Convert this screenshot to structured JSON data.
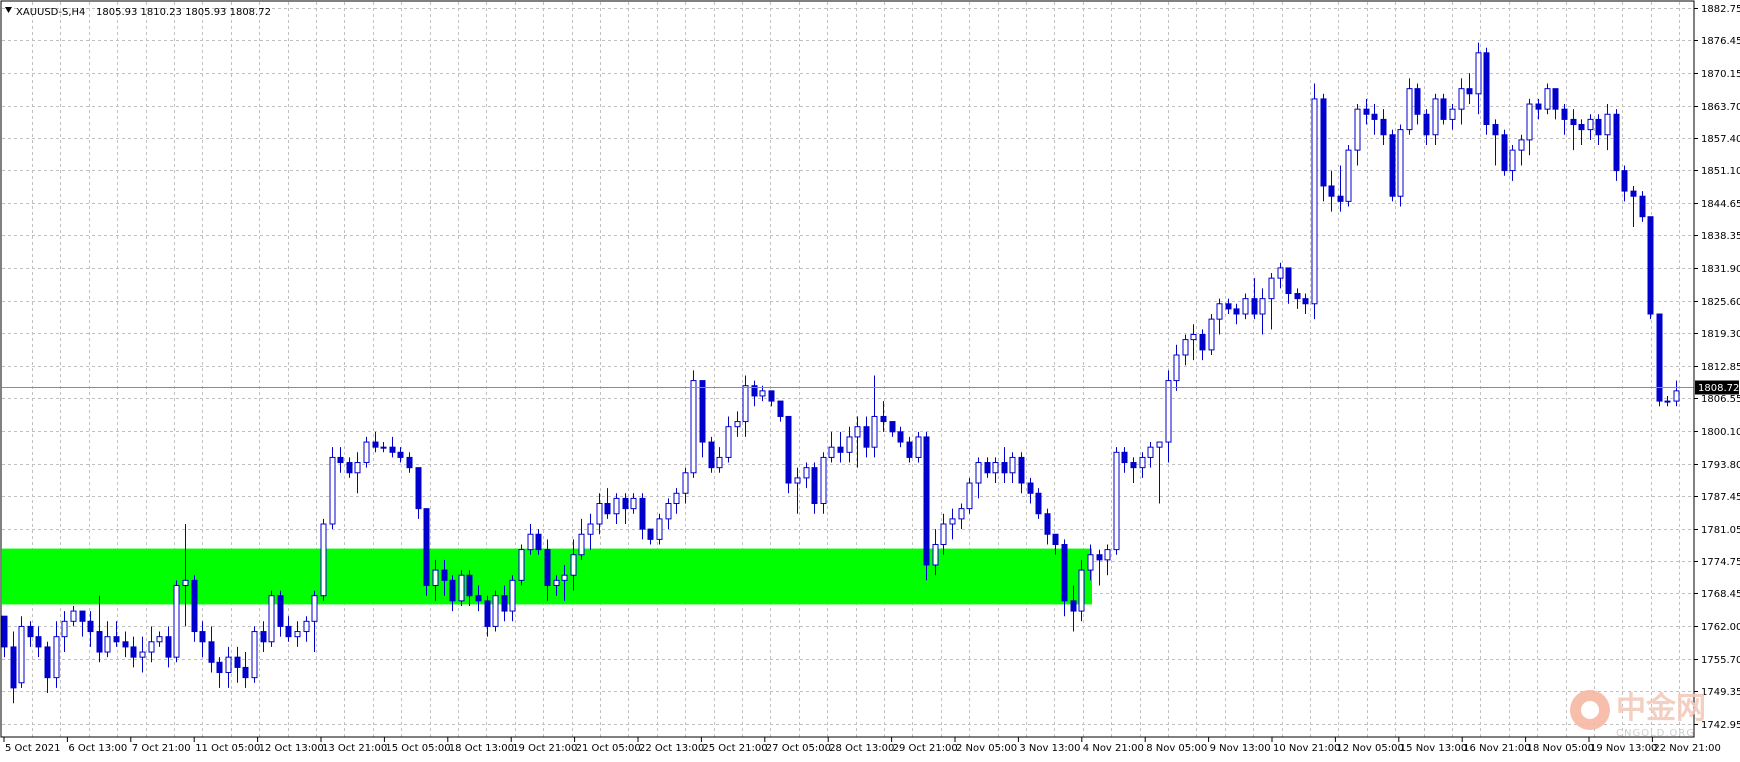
{
  "header": {
    "symbol": "XAUUSD-S,H4",
    "ohlc": "1805.93 1810.23 1805.93 1808.72"
  },
  "current_price": "1808.72",
  "watermark": {
    "brand": "中金网",
    "domain": "CNGOLD.ORG"
  },
  "colors": {
    "candle": "#0000cc",
    "zone": "#00ff00",
    "grid": "#c0c0c0",
    "flag": "#000000"
  },
  "chart_data": {
    "type": "candlestick",
    "symbol": "XAUUSD-S",
    "timeframe": "H4",
    "ylim": [
      1742.95,
      1882.75
    ],
    "y_ticks": [
      "1882.75",
      "1876.45",
      "1870.15",
      "1863.70",
      "1857.40",
      "1851.10",
      "1844.65",
      "1838.35",
      "1831.90",
      "1825.60",
      "1819.30",
      "1812.85",
      "1806.55",
      "1800.10",
      "1793.80",
      "1787.45",
      "1781.05",
      "1774.75",
      "1768.45",
      "1762.00",
      "1755.70",
      "1749.35",
      "1742.95"
    ],
    "x_ticks": [
      "5 Oct 2021",
      "6 Oct 13:00",
      "7 Oct 21:00",
      "11 Oct 05:00",
      "12 Oct 13:00",
      "13 Oct 21:00",
      "15 Oct 05:00",
      "18 Oct 13:00",
      "19 Oct 21:00",
      "21 Oct 05:00",
      "22 Oct 13:00",
      "25 Oct 21:00",
      "27 Oct 05:00",
      "28 Oct 13:00",
      "29 Oct 21:00",
      "2 Nov 05:00",
      "3 Nov 13:00",
      "4 Nov 21:00",
      "8 Nov 05:00",
      "9 Nov 13:00",
      "10 Nov 21:00",
      "12 Nov 05:00",
      "15 Nov 13:00",
      "16 Nov 21:00",
      "18 Nov 05:00",
      "19 Nov 13:00",
      "22 Nov 21:00"
    ],
    "current_price": 1808.72,
    "support_zone": [
      1766.3,
      1777.2
    ],
    "candles": [
      [
        1764,
        1764,
        1756,
        1758
      ],
      [
        1758,
        1761,
        1747,
        1750
      ],
      [
        1751,
        1764,
        1750,
        1762
      ],
      [
        1762,
        1763,
        1758,
        1760
      ],
      [
        1760,
        1762,
        1756,
        1758
      ],
      [
        1758,
        1759,
        1749,
        1752
      ],
      [
        1752,
        1763,
        1750,
        1760
      ],
      [
        1760,
        1765,
        1757,
        1763
      ],
      [
        1763,
        1766,
        1762,
        1765
      ],
      [
        1765,
        1765,
        1760,
        1763
      ],
      [
        1763,
        1765,
        1758,
        1761
      ],
      [
        1761,
        1768,
        1755,
        1757
      ],
      [
        1757,
        1763,
        1756,
        1760
      ],
      [
        1760,
        1763,
        1758,
        1759
      ],
      [
        1759,
        1761,
        1756,
        1758
      ],
      [
        1758,
        1760,
        1754,
        1756
      ],
      [
        1756,
        1760,
        1753,
        1757
      ],
      [
        1757,
        1762,
        1755,
        1759
      ],
      [
        1759,
        1761,
        1758,
        1760
      ],
      [
        1760,
        1762,
        1754,
        1756
      ],
      [
        1756,
        1771,
        1755,
        1770
      ],
      [
        1770,
        1782,
        1762,
        1771
      ],
      [
        1771,
        1772,
        1759,
        1761
      ],
      [
        1761,
        1763,
        1756,
        1759
      ],
      [
        1759,
        1762,
        1753,
        1755
      ],
      [
        1755,
        1756,
        1750,
        1753
      ],
      [
        1753,
        1758,
        1750,
        1756
      ],
      [
        1756,
        1758,
        1751,
        1754
      ],
      [
        1754,
        1757,
        1750,
        1752
      ],
      [
        1752,
        1762,
        1751,
        1761
      ],
      [
        1761,
        1763,
        1757,
        1759
      ],
      [
        1759,
        1769,
        1758,
        1768
      ],
      [
        1768,
        1769,
        1760,
        1762
      ],
      [
        1762,
        1764,
        1759,
        1760
      ],
      [
        1760,
        1763,
        1758,
        1761
      ],
      [
        1761,
        1764,
        1759,
        1763
      ],
      [
        1763,
        1769,
        1757,
        1768
      ],
      [
        1768,
        1783,
        1767,
        1782
      ],
      [
        1782,
        1797,
        1781,
        1795
      ],
      [
        1795,
        1797,
        1792,
        1794
      ],
      [
        1794,
        1795,
        1791,
        1792
      ],
      [
        1792,
        1796,
        1788,
        1794
      ],
      [
        1794,
        1799,
        1793,
        1798
      ],
      [
        1798,
        1800,
        1796,
        1797
      ],
      [
        1797,
        1798,
        1796,
        1797
      ],
      [
        1797,
        1799,
        1795,
        1796
      ],
      [
        1796,
        1797,
        1794,
        1795
      ],
      [
        1795,
        1796,
        1792,
        1793
      ],
      [
        1793,
        1793,
        1783,
        1785
      ],
      [
        1785,
        1785,
        1768,
        1770
      ],
      [
        1770,
        1775,
        1767,
        1773
      ],
      [
        1773,
        1775,
        1768,
        1771
      ],
      [
        1771,
        1772,
        1765,
        1767
      ],
      [
        1767,
        1773,
        1766,
        1772
      ],
      [
        1772,
        1773,
        1766,
        1768
      ],
      [
        1768,
        1770,
        1765,
        1767
      ],
      [
        1767,
        1768,
        1760,
        1762
      ],
      [
        1762,
        1769,
        1761,
        1768
      ],
      [
        1768,
        1770,
        1763,
        1765
      ],
      [
        1765,
        1772,
        1763,
        1771
      ],
      [
        1771,
        1778,
        1770,
        1777
      ],
      [
        1777,
        1782,
        1776,
        1780
      ],
      [
        1780,
        1781,
        1776,
        1777
      ],
      [
        1777,
        1779,
        1767,
        1770
      ],
      [
        1770,
        1772,
        1768,
        1771
      ],
      [
        1771,
        1774,
        1767,
        1772
      ],
      [
        1772,
        1779,
        1769,
        1776
      ],
      [
        1776,
        1783,
        1775,
        1780
      ],
      [
        1780,
        1784,
        1777,
        1782
      ],
      [
        1782,
        1788,
        1780,
        1786
      ],
      [
        1786,
        1789,
        1783,
        1784
      ],
      [
        1784,
        1788,
        1782,
        1787
      ],
      [
        1787,
        1788,
        1782,
        1785
      ],
      [
        1785,
        1788,
        1784,
        1787
      ],
      [
        1787,
        1788,
        1779,
        1781
      ],
      [
        1781,
        1781,
        1778,
        1779
      ],
      [
        1779,
        1784,
        1778,
        1783
      ],
      [
        1783,
        1787,
        1781,
        1786
      ],
      [
        1786,
        1789,
        1784,
        1788
      ],
      [
        1788,
        1793,
        1786,
        1792
      ],
      [
        1792,
        1812,
        1791,
        1810
      ],
      [
        1810,
        1810,
        1795,
        1798
      ],
      [
        1798,
        1799,
        1792,
        1793
      ],
      [
        1793,
        1797,
        1792,
        1795
      ],
      [
        1795,
        1803,
        1794,
        1801
      ],
      [
        1801,
        1804,
        1799,
        1802
      ],
      [
        1802,
        1811,
        1799,
        1809
      ],
      [
        1809,
        1810,
        1805,
        1807
      ],
      [
        1807,
        1809,
        1806,
        1808
      ],
      [
        1808,
        1808,
        1805,
        1806
      ],
      [
        1806,
        1806,
        1802,
        1803
      ],
      [
        1803,
        1803,
        1788,
        1790
      ],
      [
        1790,
        1793,
        1784,
        1791
      ],
      [
        1791,
        1794,
        1789,
        1793
      ],
      [
        1793,
        1794,
        1784,
        1786
      ],
      [
        1786,
        1796,
        1784,
        1795
      ],
      [
        1795,
        1800,
        1794,
        1797
      ],
      [
        1797,
        1800,
        1794,
        1796
      ],
      [
        1796,
        1801,
        1794,
        1799
      ],
      [
        1799,
        1803,
        1793,
        1801
      ],
      [
        1801,
        1803,
        1795,
        1797
      ],
      [
        1797,
        1811,
        1795,
        1803
      ],
      [
        1803,
        1806,
        1800,
        1802
      ],
      [
        1802,
        1802,
        1799,
        1800
      ],
      [
        1800,
        1801,
        1797,
        1798
      ],
      [
        1798,
        1799,
        1794,
        1795
      ],
      [
        1795,
        1800,
        1794,
        1799
      ],
      [
        1799,
        1800,
        1771,
        1774
      ],
      [
        1774,
        1781,
        1772,
        1778
      ],
      [
        1778,
        1784,
        1776,
        1782
      ],
      [
        1782,
        1785,
        1779,
        1783
      ],
      [
        1783,
        1786,
        1781,
        1785
      ],
      [
        1785,
        1791,
        1784,
        1790
      ],
      [
        1790,
        1795,
        1787,
        1794
      ],
      [
        1794,
        1795,
        1791,
        1792
      ],
      [
        1792,
        1795,
        1790,
        1794
      ],
      [
        1794,
        1797,
        1790,
        1792
      ],
      [
        1792,
        1796,
        1790,
        1795
      ],
      [
        1795,
        1796,
        1788,
        1790
      ],
      [
        1790,
        1791,
        1786,
        1788
      ],
      [
        1788,
        1789,
        1783,
        1784
      ],
      [
        1784,
        1785,
        1778,
        1780
      ],
      [
        1780,
        1780,
        1776,
        1778
      ],
      [
        1778,
        1779,
        1764,
        1767
      ],
      [
        1767,
        1770,
        1761,
        1765
      ],
      [
        1765,
        1775,
        1763,
        1773
      ],
      [
        1773,
        1778,
        1771,
        1776
      ],
      [
        1776,
        1777,
        1770,
        1775
      ],
      [
        1775,
        1778,
        1772,
        1777
      ],
      [
        1777,
        1797,
        1776,
        1796
      ],
      [
        1796,
        1797,
        1792,
        1794
      ],
      [
        1794,
        1795,
        1790,
        1793
      ],
      [
        1793,
        1796,
        1791,
        1795
      ],
      [
        1795,
        1798,
        1793,
        1797
      ],
      [
        1797,
        1798,
        1786,
        1798
      ],
      [
        1798,
        1812,
        1794,
        1810
      ],
      [
        1810,
        1817,
        1808,
        1815
      ],
      [
        1815,
        1819,
        1813,
        1818
      ],
      [
        1818,
        1821,
        1814,
        1819
      ],
      [
        1819,
        1820,
        1814,
        1816
      ],
      [
        1816,
        1823,
        1815,
        1822
      ],
      [
        1822,
        1826,
        1819,
        1825
      ],
      [
        1825,
        1826,
        1823,
        1824
      ],
      [
        1824,
        1825,
        1821,
        1823
      ],
      [
        1823,
        1827,
        1822,
        1826
      ],
      [
        1826,
        1830,
        1822,
        1823
      ],
      [
        1823,
        1828,
        1819,
        1826
      ],
      [
        1826,
        1831,
        1820,
        1830
      ],
      [
        1830,
        1833,
        1828,
        1832
      ],
      [
        1832,
        1832,
        1825,
        1827
      ],
      [
        1827,
        1828,
        1824,
        1826
      ],
      [
        1826,
        1827,
        1823,
        1825
      ],
      [
        1825,
        1868,
        1822,
        1865
      ],
      [
        1865,
        1866,
        1845,
        1848
      ],
      [
        1848,
        1851,
        1843,
        1846
      ],
      [
        1846,
        1852,
        1843,
        1845
      ],
      [
        1845,
        1856,
        1844,
        1855
      ],
      [
        1855,
        1864,
        1852,
        1863
      ],
      [
        1863,
        1865,
        1860,
        1862
      ],
      [
        1862,
        1864,
        1858,
        1861
      ],
      [
        1861,
        1863,
        1856,
        1858
      ],
      [
        1858,
        1859,
        1845,
        1846
      ],
      [
        1846,
        1860,
        1844,
        1859
      ],
      [
        1859,
        1869,
        1858,
        1867
      ],
      [
        1867,
        1868,
        1860,
        1862
      ],
      [
        1862,
        1863,
        1856,
        1858
      ],
      [
        1858,
        1866,
        1856,
        1865
      ],
      [
        1865,
        1866,
        1860,
        1861
      ],
      [
        1861,
        1864,
        1859,
        1863
      ],
      [
        1863,
        1869,
        1860,
        1867
      ],
      [
        1867,
        1870,
        1864,
        1866
      ],
      [
        1866,
        1876,
        1862,
        1874
      ],
      [
        1874,
        1875,
        1858,
        1860
      ],
      [
        1860,
        1861,
        1852,
        1858
      ],
      [
        1858,
        1859,
        1850,
        1851
      ],
      [
        1851,
        1856,
        1849,
        1855
      ],
      [
        1855,
        1858,
        1852,
        1857
      ],
      [
        1857,
        1865,
        1854,
        1864
      ],
      [
        1864,
        1865,
        1861,
        1863
      ],
      [
        1863,
        1868,
        1862,
        1867
      ],
      [
        1867,
        1867,
        1861,
        1863
      ],
      [
        1863,
        1864,
        1858,
        1861
      ],
      [
        1861,
        1863,
        1855,
        1860
      ],
      [
        1860,
        1861,
        1856,
        1859
      ],
      [
        1859,
        1862,
        1857,
        1861
      ],
      [
        1861,
        1862,
        1856,
        1858
      ],
      [
        1858,
        1864,
        1855,
        1862
      ],
      [
        1862,
        1863,
        1849,
        1851
      ],
      [
        1851,
        1852,
        1845,
        1847
      ],
      [
        1847,
        1848,
        1840,
        1846
      ],
      [
        1846,
        1847,
        1841,
        1842
      ],
      [
        1842,
        1842,
        1822,
        1823
      ],
      [
        1823,
        1823,
        1805,
        1806
      ],
      [
        1806,
        1807,
        1805,
        1806
      ],
      [
        1806,
        1810,
        1805,
        1808
      ]
    ]
  }
}
